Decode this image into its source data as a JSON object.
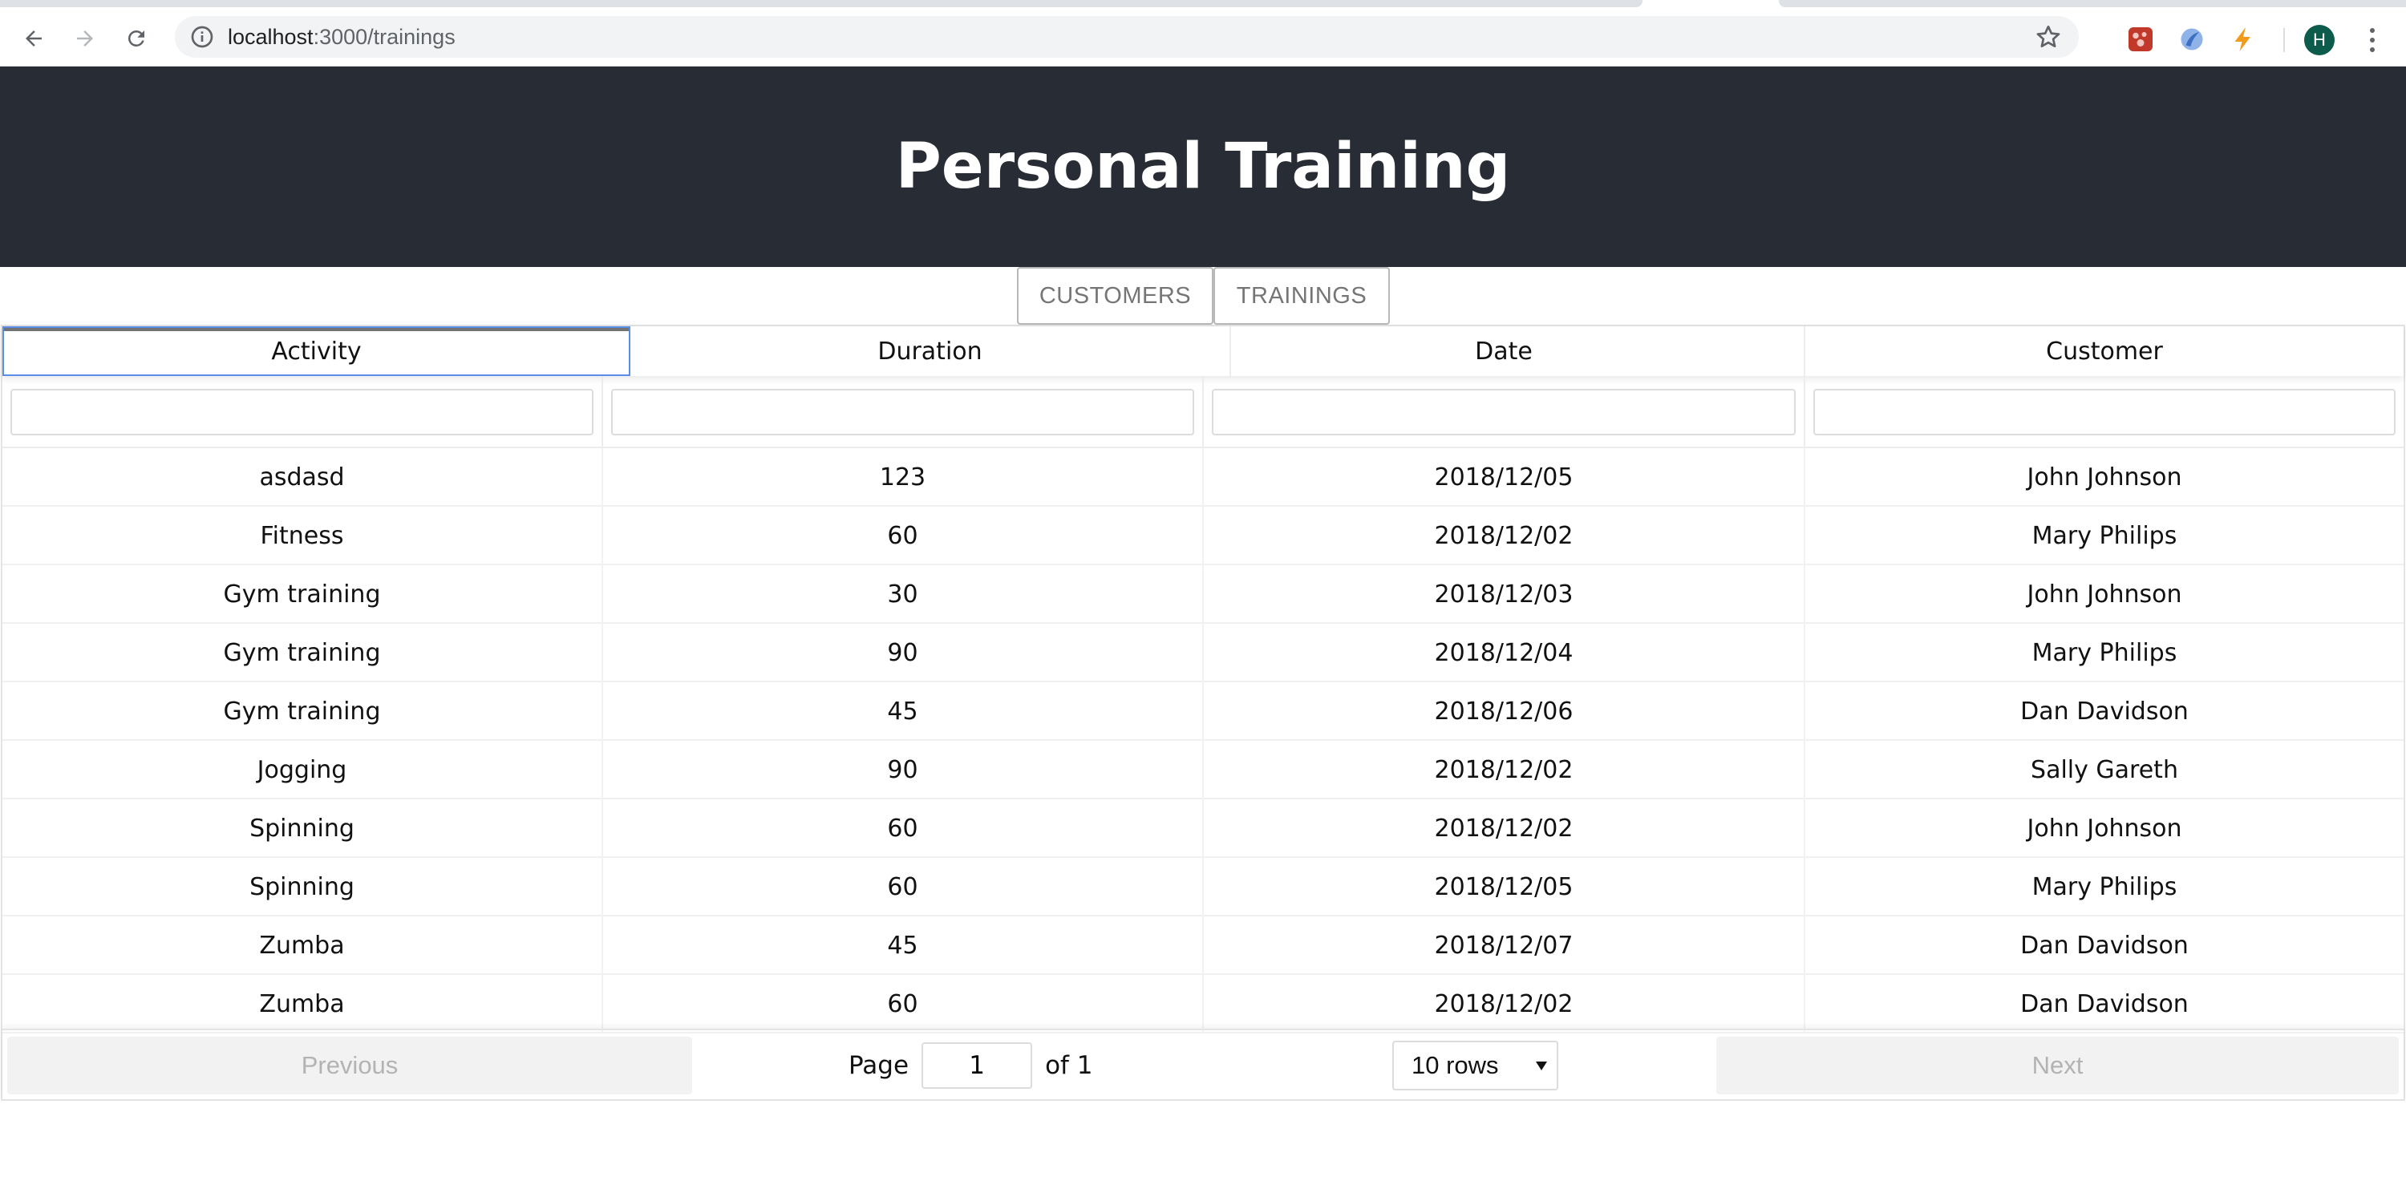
{
  "browser": {
    "url_host": "localhost",
    "url_path": ":3000/trainings",
    "profile_initial": "H"
  },
  "app": {
    "title": "Personal Training"
  },
  "nav": {
    "customers_label": "CUSTOMERS",
    "trainings_label": "TRAININGS"
  },
  "table": {
    "columns": [
      "Activity",
      "Duration",
      "Date",
      "Customer"
    ],
    "sorted_column": "Activity",
    "rows": [
      [
        "asdasd",
        "123",
        "2018/12/05",
        "John Johnson"
      ],
      [
        "Fitness",
        "60",
        "2018/12/02",
        "Mary Philips"
      ],
      [
        "Gym training",
        "30",
        "2018/12/03",
        "John Johnson"
      ],
      [
        "Gym training",
        "90",
        "2018/12/04",
        "Mary Philips"
      ],
      [
        "Gym training",
        "45",
        "2018/12/06",
        "Dan Davidson"
      ],
      [
        "Jogging",
        "90",
        "2018/12/02",
        "Sally Gareth"
      ],
      [
        "Spinning",
        "60",
        "2018/12/02",
        "John Johnson"
      ],
      [
        "Spinning",
        "60",
        "2018/12/05",
        "Mary Philips"
      ],
      [
        "Zumba",
        "45",
        "2018/12/07",
        "Dan Davidson"
      ],
      [
        "Zumba",
        "60",
        "2018/12/02",
        "Dan Davidson"
      ]
    ]
  },
  "pagination": {
    "previous_label": "Previous",
    "next_label": "Next",
    "page_label": "Page",
    "page_value": "1",
    "of_label": "of 1",
    "rows_option": "10 rows"
  }
}
